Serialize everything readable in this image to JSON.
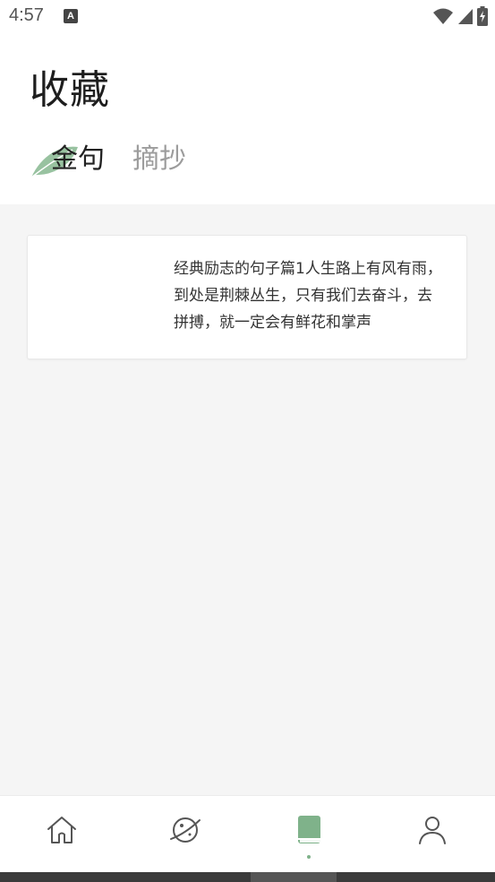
{
  "status_bar": {
    "time": "4:57",
    "notification_icon": "a-icon",
    "notification_letter": "A",
    "icons": [
      "wifi-icon",
      "cell-signal-icon",
      "battery-charging-icon"
    ]
  },
  "header": {
    "title": "收藏"
  },
  "tabs": [
    {
      "label": "金句",
      "active": true
    },
    {
      "label": "摘抄",
      "active": false
    }
  ],
  "cards": [
    {
      "text": "经典励志的句子篇1人生路上有风有雨，到处是荆棘丛生，只有我们去奋斗，去拼搏，就一定会有鲜花和掌声"
    }
  ],
  "bottom_nav": {
    "items": [
      {
        "name": "home",
        "icon": "home-icon",
        "active": false
      },
      {
        "name": "discover",
        "icon": "planet-icon",
        "active": false
      },
      {
        "name": "collection",
        "icon": "book-icon",
        "active": true
      },
      {
        "name": "profile",
        "icon": "user-icon",
        "active": false
      }
    ]
  },
  "colors": {
    "accent": "#7fb28a",
    "inactive_tab": "#9c9c9c",
    "nav_icon": "#555555",
    "background": "#f5f5f5"
  }
}
